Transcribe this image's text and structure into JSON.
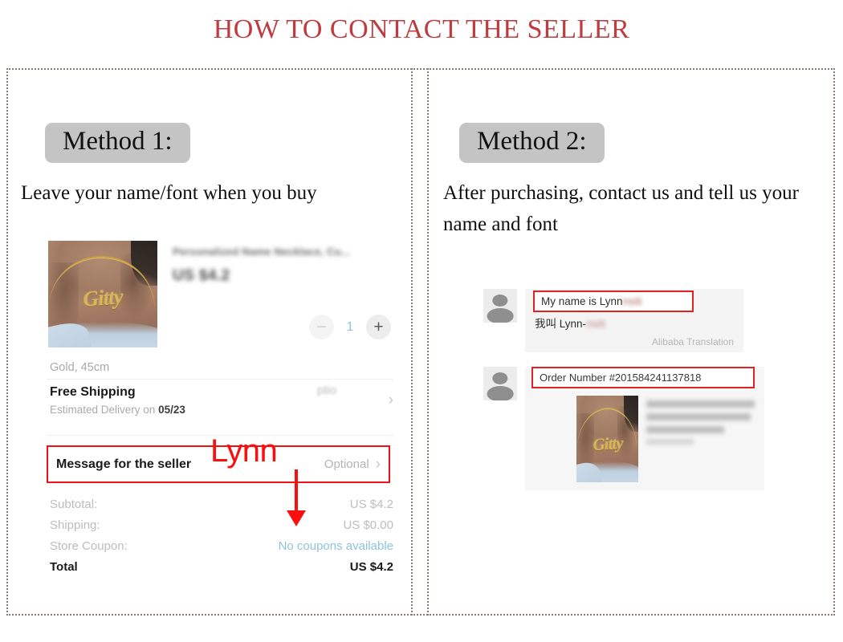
{
  "page": {
    "title": "HOW TO CONTACT THE SELLER",
    "title_color": "#bf3b3f",
    "border_color": "#8a7a6d",
    "annotation_color": "#fa0f0f"
  },
  "method1": {
    "badge": "Method 1:",
    "description": "Leave your name/font when you buy",
    "annotation": {
      "text": "Lynn",
      "arrow": "down-arrow"
    },
    "phone": {
      "product": {
        "title_blurred": "Personalized Name Necklace, Cu...",
        "price_blurred": "US $4.2",
        "variant": "Gold, 45cm",
        "photo_pendant_name": "Gitty"
      },
      "quantity": {
        "minus_label": "−",
        "value": "1",
        "plus_label": "+"
      },
      "shipping": {
        "title": "Free Shipping",
        "subtitle_prefix": "Estimated Delivery on ",
        "subtitle_date": "05/23",
        "optional_blurred": "ptio",
        "chevron": "chevron-right-icon"
      },
      "message_row": {
        "label": "Message for the seller",
        "value": "Optional",
        "chevron": "chevron-right-icon"
      },
      "totals": [
        {
          "label": "Subtotal:",
          "value": "US $4.2",
          "style": "muted"
        },
        {
          "label": "Shipping:",
          "value": "US $0.00",
          "style": "muted"
        },
        {
          "label": "Store Coupon:",
          "value": "No coupons available",
          "style": "link"
        },
        {
          "label": "Total",
          "value": "US $4.2",
          "style": "bold"
        }
      ]
    }
  },
  "method2": {
    "badge": "Method 2:",
    "description": "After purchasing, contact us and tell us your name and font",
    "chat": {
      "message1": {
        "english": "My name is Lynn",
        "english_blurred_tail": "nsiti",
        "chinese": "我叫  Lynn-",
        "chinese_blurred_tail": "nsiti",
        "translation_label": "Alibaba Translation"
      },
      "message2": {
        "order_text": "Order Number #201584241137818",
        "card_blurred_lines": [
          "Personalized Old English Fo",
          "nt Name Necklace, & Pen...",
          "Payment processing",
          "... 1pc"
        ],
        "photo_pendant_name": "Gitty"
      }
    }
  }
}
